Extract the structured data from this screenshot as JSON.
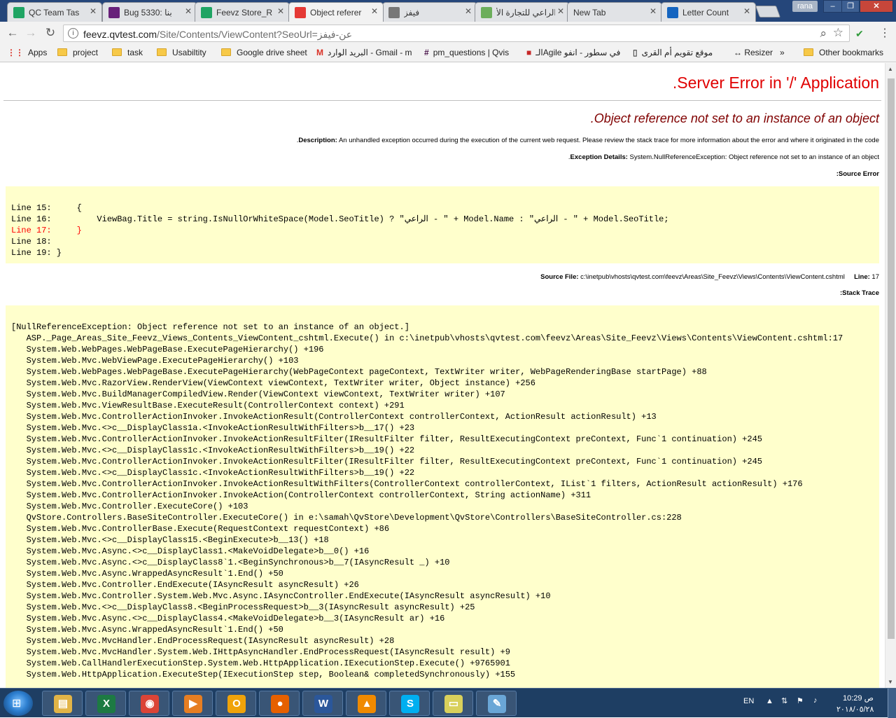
{
  "tabs": [
    {
      "title": "QC Team Tas",
      "icon": "sheets-icon",
      "color": "#1fa463"
    },
    {
      "title": "Bug 5330: بنا",
      "icon": "visual-studio-icon",
      "color": "#68217a"
    },
    {
      "title": "Feevz Store_R",
      "icon": "sheets-icon",
      "color": "#1fa463"
    },
    {
      "title": "Object referer",
      "icon": "error-page-icon",
      "color": "#e53935"
    },
    {
      "title": "فيفز",
      "icon": "dollar-icon",
      "color": "#777777"
    },
    {
      "title": "الراعي للتجارة الأ",
      "icon": "site-icon",
      "color": "#6cae5b"
    },
    {
      "title": "New Tab",
      "icon": "",
      "color": ""
    },
    {
      "title": "Letter Count",
      "icon": "letter-count-icon",
      "color": "#1565c0"
    }
  ],
  "window": {
    "user": "rana"
  },
  "address_bar": {
    "host": "feevz.qvtest.com",
    "path": "/Site/Contents/ViewContent?SeoUrl=عن-فيفز"
  },
  "bookmarks": [
    {
      "label": "Apps",
      "type": "apps"
    },
    {
      "label": "project",
      "type": "folder"
    },
    {
      "label": "task",
      "type": "folder"
    },
    {
      "label": "Usabiltity",
      "type": "folder"
    },
    {
      "label": "Google drive sheet",
      "type": "folder"
    },
    {
      "label": "البريد الوارد - Gmail - m",
      "type": "gmail"
    },
    {
      "label": "pm_questions | Qvis",
      "type": "slack"
    },
    {
      "label": "الـAgile في سطور - انفو",
      "type": "site"
    },
    {
      "label": "موقع تقويم أم القرى",
      "type": "page"
    },
    {
      "label": "↔ Resizer",
      "type": "plain"
    },
    {
      "label": "»",
      "type": "plain"
    },
    {
      "label": "Other bookmarks",
      "type": "folder"
    }
  ],
  "error_page": {
    "title": "Server Error in '/' Application.",
    "message": "Object reference not set to an instance of an object.",
    "description_label": "Description:",
    "description_text": "An unhandled exception occurred during the execution of the current web request. Please review the stack trace for more information about the error and where it originated in the code.",
    "exception_label": "Exception Details:",
    "exception_text": "System.NullReferenceException: Object reference not set to an instance of an object.",
    "source_error_label": "Source Error:",
    "source_lines": [
      {
        "text": "",
        "highlight": false
      },
      {
        "text": "Line 15:     {",
        "highlight": false
      },
      {
        "text": "Line 16:         ViewBag.Title = string.IsNullOrWhiteSpace(Model.SeoTitle) ? \"الراعي - \" + Model.Name : \"الراعي - \" + Model.SeoTitle;",
        "highlight": false
      },
      {
        "text": "Line 17:     }",
        "highlight": true
      },
      {
        "text": "Line 18:",
        "highlight": false
      },
      {
        "text": "Line 19: }",
        "highlight": false
      }
    ],
    "source_file_label": "Source File:",
    "source_file_path": "c:\\inetpub\\vhosts\\qvtest.com\\feevz\\Areas\\Site_Feevz\\Views\\Contents\\ViewContent.cshtml",
    "line_label": "Line:",
    "line_number": "17",
    "stack_trace_label": "Stack Trace:",
    "stack_lines": [
      "",
      "[NullReferenceException: Object reference not set to an instance of an object.]",
      "   ASP._Page_Areas_Site_Feevz_Views_Contents_ViewContent_cshtml.Execute() in c:\\inetpub\\vhosts\\qvtest.com\\feevz\\Areas\\Site_Feevz\\Views\\Contents\\ViewContent.cshtml:17",
      "   System.Web.WebPages.WebPageBase.ExecutePageHierarchy() +196",
      "   System.Web.Mvc.WebViewPage.ExecutePageHierarchy() +103",
      "   System.Web.WebPages.WebPageBase.ExecutePageHierarchy(WebPageContext pageContext, TextWriter writer, WebPageRenderingBase startPage) +88",
      "   System.Web.Mvc.RazorView.RenderView(ViewContext viewContext, TextWriter writer, Object instance) +256",
      "   System.Web.Mvc.BuildManagerCompiledView.Render(ViewContext viewContext, TextWriter writer) +107",
      "   System.Web.Mvc.ViewResultBase.ExecuteResult(ControllerContext context) +291",
      "   System.Web.Mvc.ControllerActionInvoker.InvokeActionResult(ControllerContext controllerContext, ActionResult actionResult) +13",
      "   System.Web.Mvc.<>c__DisplayClass1a.<InvokeActionResultWithFilters>b__17() +23",
      "   System.Web.Mvc.ControllerActionInvoker.InvokeActionResultFilter(IResultFilter filter, ResultExecutingContext preContext, Func`1 continuation) +245",
      "   System.Web.Mvc.<>c__DisplayClass1c.<InvokeActionResultWithFilters>b__19() +22",
      "   System.Web.Mvc.ControllerActionInvoker.InvokeActionResultFilter(IResultFilter filter, ResultExecutingContext preContext, Func`1 continuation) +245",
      "   System.Web.Mvc.<>c__DisplayClass1c.<InvokeActionResultWithFilters>b__19() +22",
      "   System.Web.Mvc.ControllerActionInvoker.InvokeActionResultWithFilters(ControllerContext controllerContext, IList`1 filters, ActionResult actionResult) +176",
      "   System.Web.Mvc.ControllerActionInvoker.InvokeAction(ControllerContext controllerContext, String actionName) +311",
      "   System.Web.Mvc.Controller.ExecuteCore() +103",
      "   QvStore.Controllers.BaseSiteController.ExecuteCore() in e:\\samah\\QvStore\\Development\\QvStore\\Controllers\\BaseSiteController.cs:228",
      "   System.Web.Mvc.ControllerBase.Execute(RequestContext requestContext) +86",
      "   System.Web.Mvc.<>c__DisplayClass15.<BeginExecute>b__13() +18",
      "   System.Web.Mvc.Async.<>c__DisplayClass1.<MakeVoidDelegate>b__0() +16",
      "   System.Web.Mvc.Async.<>c__DisplayClass8`1.<BeginSynchronous>b__7(IAsyncResult _) +10",
      "   System.Web.Mvc.Async.WrappedAsyncResult`1.End() +50",
      "   System.Web.Mvc.Controller.EndExecute(IAsyncResult asyncResult) +26",
      "   System.Web.Mvc.Controller.System.Web.Mvc.Async.IAsyncController.EndExecute(IAsyncResult asyncResult) +10",
      "   System.Web.Mvc.<>c__DisplayClass8.<BeginProcessRequest>b__3(IAsyncResult asyncResult) +25",
      "   System.Web.Mvc.Async.<>c__DisplayClass4.<MakeVoidDelegate>b__3(IAsyncResult ar) +16",
      "   System.Web.Mvc.Async.WrappedAsyncResult`1.End() +50",
      "   System.Web.Mvc.MvcHandler.EndProcessRequest(IAsyncResult asyncResult) +28",
      "   System.Web.Mvc.MvcHandler.System.Web.IHttpAsyncHandler.EndProcessRequest(IAsyncResult result) +9",
      "   System.Web.CallHandlerExecutionStep.System.Web.HttpApplication.IExecutionStep.Execute() +9765901",
      "   System.Web.HttpApplication.ExecuteStep(IExecutionStep step, Boolean& completedSynchronously) +155"
    ]
  },
  "taskbar": {
    "apps": [
      {
        "name": "file-explorer",
        "glyph": "▤",
        "color": "#e2b447"
      },
      {
        "name": "excel",
        "glyph": "X",
        "color": "#1d7a43"
      },
      {
        "name": "chrome",
        "glyph": "◉",
        "color": "#db4437"
      },
      {
        "name": "media-player",
        "glyph": "▶",
        "color": "#e67e22"
      },
      {
        "name": "outlook",
        "glyph": "O",
        "color": "#f0a30a"
      },
      {
        "name": "firefox",
        "glyph": "●",
        "color": "#e66000"
      },
      {
        "name": "word",
        "glyph": "W",
        "color": "#2b579a"
      },
      {
        "name": "vlc",
        "glyph": "▲",
        "color": "#f08a00"
      },
      {
        "name": "skype",
        "glyph": "S",
        "color": "#00aff0"
      },
      {
        "name": "sticky-notes",
        "glyph": "▭",
        "color": "#d9d05b"
      },
      {
        "name": "paint",
        "glyph": "✎",
        "color": "#6aa6d6"
      }
    ],
    "language": "EN",
    "time": "10:29 ص",
    "date": "٢٠١٨/٠٥/٢٨"
  }
}
